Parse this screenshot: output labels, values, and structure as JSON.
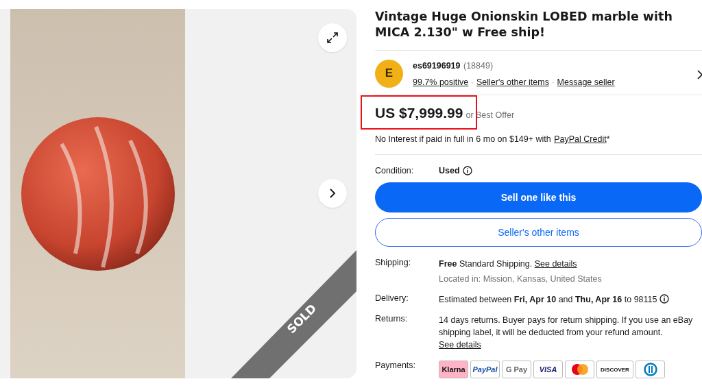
{
  "gallery": {
    "badge": "SOLD"
  },
  "title": "Vintage Huge Onionskin LOBED marble with MICA 2.130\" w Free ship!",
  "seller": {
    "initial": "E",
    "name": "es69196919",
    "count": "(18849)",
    "separator": "·",
    "links": [
      "99.7% positive",
      "Seller's other items",
      "Message seller"
    ]
  },
  "price": {
    "amount": "US $7,999.99",
    "suffix": "or Best Offer",
    "highlighted": true
  },
  "financing": {
    "text": "No Interest if paid in full in 6 mo on $149+ with",
    "link": "PayPal Credit",
    "mark": "*"
  },
  "condition": {
    "label": "Condition:",
    "value": "Used"
  },
  "buttons": [
    {
      "label": "Sell one like this",
      "kind": "primary"
    },
    {
      "label": "Seller's other items",
      "kind": "secondary"
    }
  ],
  "details": [
    {
      "label": "Shipping:",
      "text": "**Free** Standard Shipping.",
      "link": "See details",
      "link_block": false,
      "note": "Located in: Mission, Kansas, United States",
      "info": false
    },
    {
      "label": "Delivery:",
      "text": "Estimated between **Fri, Apr 10** and **Thu, Apr 16** to 98115",
      "info": true
    },
    {
      "label": "Returns:",
      "text": "14 days returns. Buyer pays for return shipping. If you use an eBay shipping label, it will be deducted from your refund amount.",
      "link": "See details",
      "link_block": true,
      "info": false
    }
  ],
  "payments": {
    "label": "Payments:",
    "methods": [
      {
        "kind": "klarna",
        "label": "Klarna"
      },
      {
        "kind": "paypal",
        "label": "PayPal"
      },
      {
        "kind": "gpay",
        "label": "G Pay"
      },
      {
        "kind": "visa",
        "label": "VISA"
      },
      {
        "kind": "mastercard"
      },
      {
        "kind": "discover",
        "label": "DISCOVER"
      },
      {
        "kind": "diners"
      }
    ]
  }
}
